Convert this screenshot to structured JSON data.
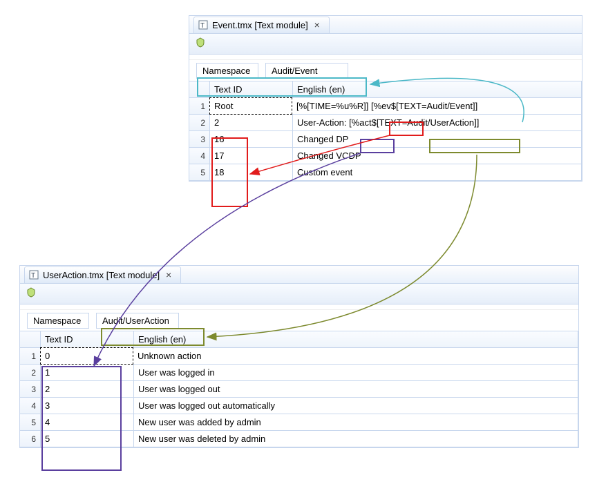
{
  "event_window": {
    "tab_title": "Event.tmx [Text module]",
    "namespace_label": "Namespace",
    "namespace_value": "Audit/Event",
    "columns": {
      "text_id": "Text ID",
      "english": "English (en)"
    },
    "rows": [
      {
        "n": "1",
        "text_id": "Root",
        "english": "[%[TIME=%u%R]] [%ev$[TEXT=Audit/Event]]"
      },
      {
        "n": "2",
        "text_id": "2",
        "english": "User-Action: [%act$[TEXT=Audit/UserAction]]"
      },
      {
        "n": "3",
        "text_id": "16",
        "english": "Changed DP"
      },
      {
        "n": "4",
        "text_id": "17",
        "english": "Changed VCDP"
      },
      {
        "n": "5",
        "text_id": "18",
        "english": "Custom event"
      }
    ]
  },
  "user_window": {
    "tab_title": "UserAction.tmx [Text module]",
    "namespace_label": "Namespace",
    "namespace_value": "Audit/UserAction",
    "columns": {
      "text_id": "Text ID",
      "english": "English (en)"
    },
    "rows": [
      {
        "n": "1",
        "text_id": "0",
        "english": "Unknown action"
      },
      {
        "n": "2",
        "text_id": "1",
        "english": "User was logged in"
      },
      {
        "n": "3",
        "text_id": "2",
        "english": "User was logged out"
      },
      {
        "n": "4",
        "text_id": "3",
        "english": "User was logged out automatically"
      },
      {
        "n": "5",
        "text_id": "4",
        "english": "New user was added by admin"
      },
      {
        "n": "6",
        "text_id": "5",
        "english": "New user was deleted by admin"
      }
    ]
  },
  "highlights": {
    "teal": "#4bb8c7",
    "red": "#e11b1b",
    "purple": "#5a3f9e",
    "olive": "#7d8a2e"
  }
}
